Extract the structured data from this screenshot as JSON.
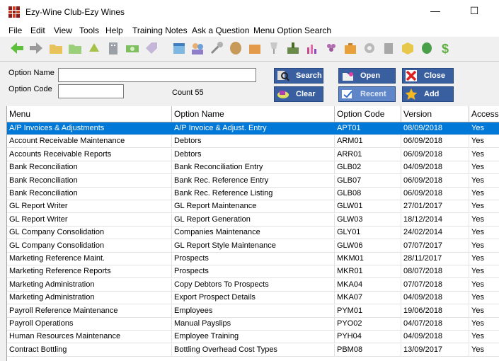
{
  "window": {
    "title": "Ezy-Wine Club-Ezy Wines",
    "minimize": "—",
    "maximize": "☐"
  },
  "menubar": [
    "File",
    "Edit",
    "View",
    "Tools",
    "Help",
    "Training Notes",
    "Ask a Question",
    "Menu Option Search"
  ],
  "toolbar_icons": [
    "back-arrow-icon",
    "forward-arrow-icon",
    "folder-icon",
    "folder-open-icon",
    "refresh-icon",
    "building-icon",
    "money-icon",
    "tag-icon",
    "calendar-icon",
    "people-icon",
    "wrench-icon",
    "barrel-icon",
    "box-icon",
    "glass-icon",
    "bottling-icon",
    "chart-icon",
    "grapes-icon",
    "suitcase-icon",
    "gear-icon",
    "cylinder-icon",
    "cube-icon",
    "leaf-icon",
    "dollar-icon"
  ],
  "search": {
    "option_name_label": "Option Name",
    "option_code_label": "Option Code",
    "option_name_value": "",
    "option_code_value": "",
    "count_text": "Count  55",
    "search_label": "Search",
    "clear_label": "Clear",
    "open_label": "Open",
    "recent_label": "Recent",
    "close_label": "Close",
    "add_label": "Add"
  },
  "colors": {
    "selection": "#0078d7",
    "button": "#3a5fa0"
  },
  "table": {
    "columns": [
      "Menu",
      "Option Name",
      "Option Code",
      "Version",
      "Access"
    ],
    "rows": [
      [
        "A/P Invoices & Adjustments",
        "A/P Invoice & Adjust. Entry",
        "APT01",
        "08/09/2018",
        "Yes"
      ],
      [
        "Account Receivable Maintenance",
        "Debtors",
        "ARM01",
        "06/09/2018",
        "Yes"
      ],
      [
        "Accounts Receivable Reports",
        "Debtors",
        "ARR01",
        "06/09/2018",
        "Yes"
      ],
      [
        "Bank Reconciliation",
        "Bank Reconciliation Entry",
        "GLB02",
        "04/09/2018",
        "Yes"
      ],
      [
        "Bank Reconciliation",
        "Bank Rec. Reference Entry",
        "GLB07",
        "06/09/2018",
        "Yes"
      ],
      [
        "Bank Reconciliation",
        "Bank Rec. Reference Listing",
        "GLB08",
        "06/09/2018",
        "Yes"
      ],
      [
        "GL Report Writer",
        "GL Report Maintenance",
        "GLW01",
        "27/01/2017",
        "Yes"
      ],
      [
        "GL Report Writer",
        "GL Report Generation",
        "GLW03",
        "18/12/2014",
        "Yes"
      ],
      [
        "GL Company Consolidation",
        "Companies Maintenance",
        "GLY01",
        "24/02/2014",
        "Yes"
      ],
      [
        "GL Company Consolidation",
        "GL Report Style Maintenance",
        "GLW06",
        "07/07/2017",
        "Yes"
      ],
      [
        "Marketing Reference Maint.",
        "Prospects",
        "MKM01",
        "28/11/2017",
        "Yes"
      ],
      [
        "Marketing Reference Reports",
        "Prospects",
        "MKR01",
        "08/07/2018",
        "Yes"
      ],
      [
        "Marketing Administration",
        "Copy Debtors To Prospects",
        "MKA04",
        "07/07/2018",
        "Yes"
      ],
      [
        "Marketing Administration",
        "Export Prospect Details",
        "MKA07",
        "04/09/2018",
        "Yes"
      ],
      [
        "Payroll Reference Maintenance",
        "Employees",
        "PYM01",
        "19/06/2018",
        "Yes"
      ],
      [
        "Payroll Operations",
        "Manual Payslips",
        "PYO02",
        "04/07/2018",
        "Yes"
      ],
      [
        "Human Resources Maintenance",
        "Employee Training",
        "PYH04",
        "04/09/2018",
        "Yes"
      ],
      [
        "Contract Bottling",
        "Bottling Overhead Cost Types",
        "PBM08",
        "13/09/2017",
        "Yes"
      ]
    ]
  }
}
